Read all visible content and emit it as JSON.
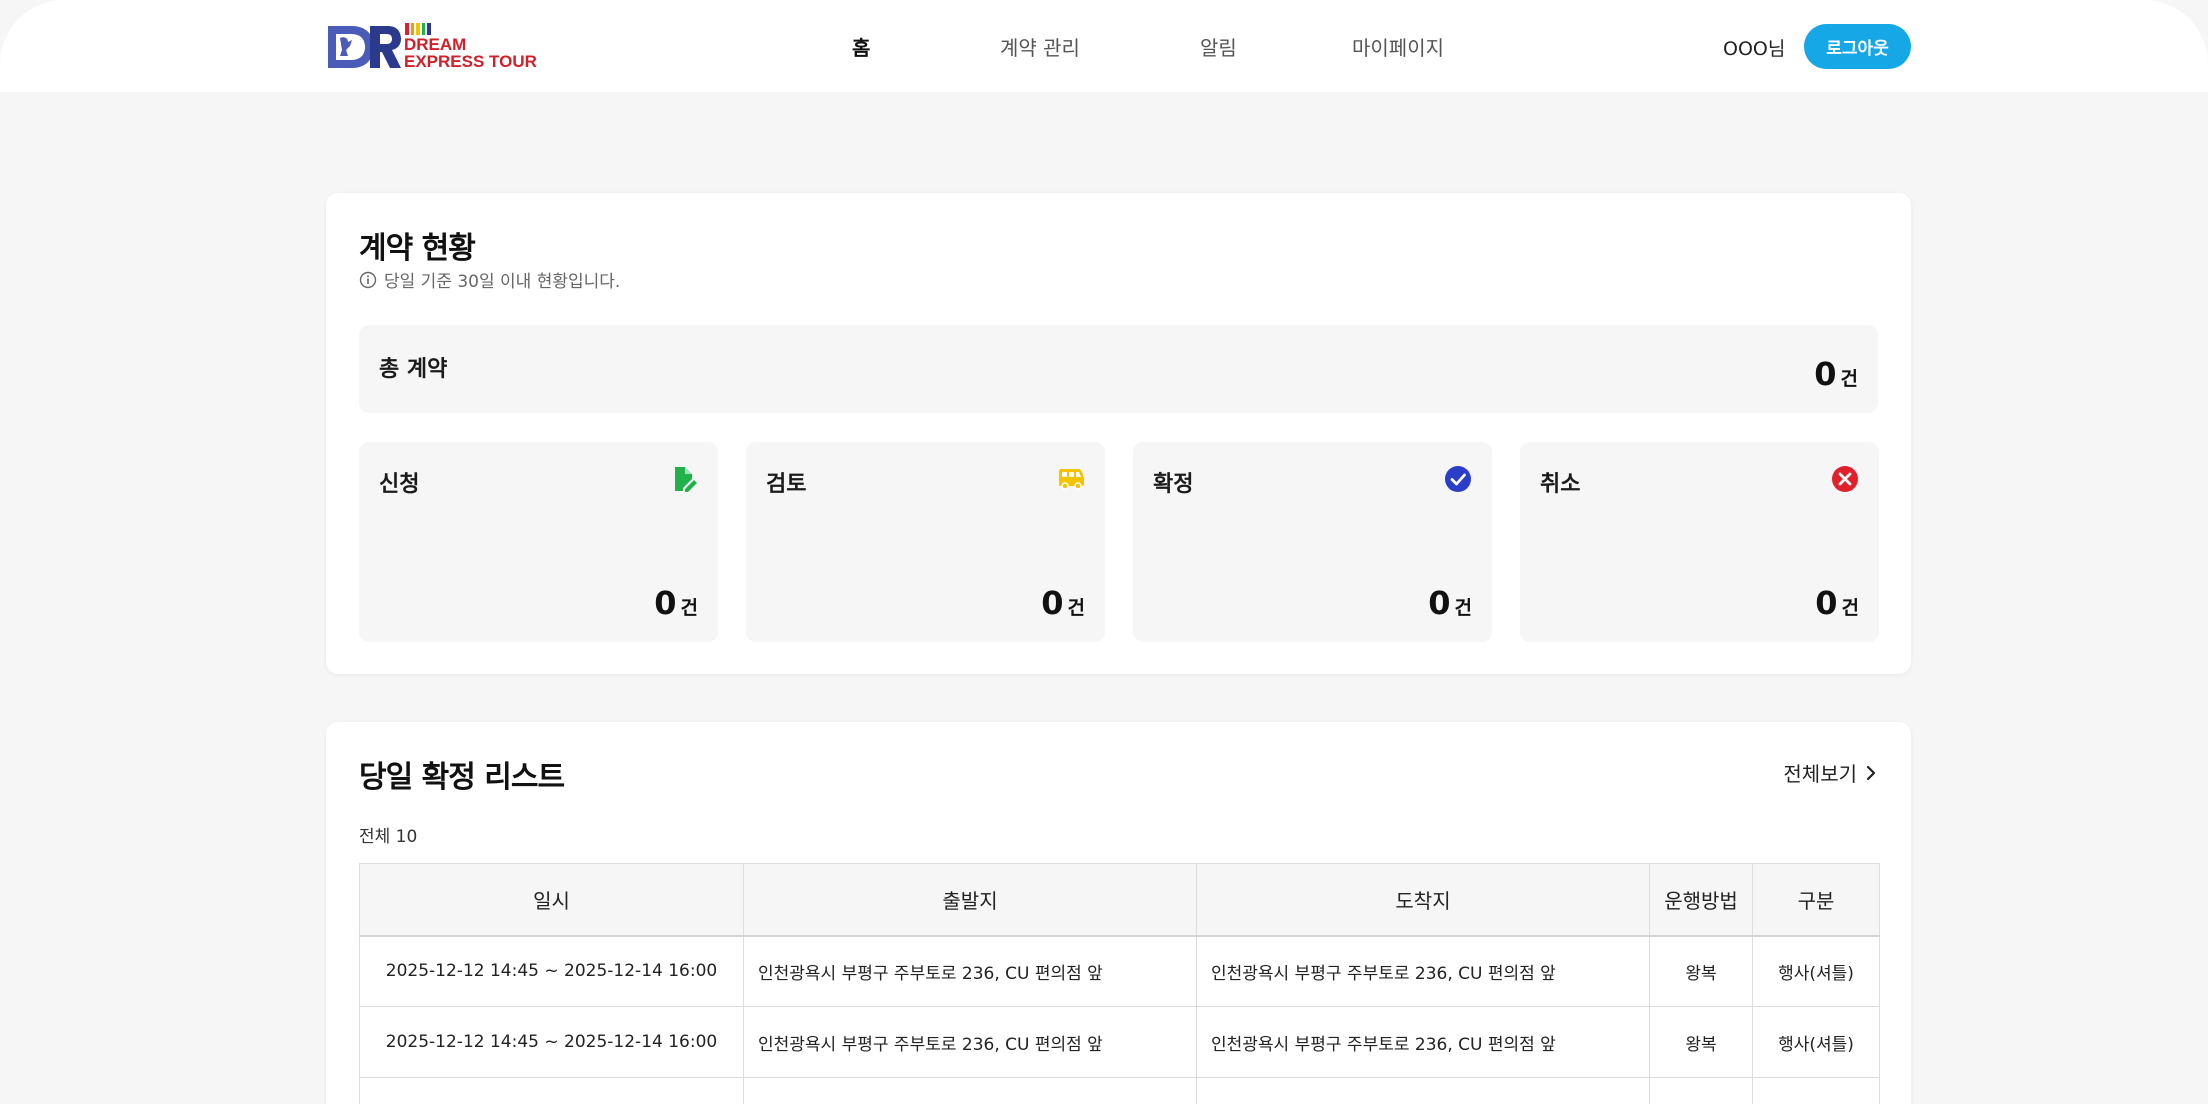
{
  "header": {
    "logo_text_line1": "DREAM",
    "logo_text_line2": "EXPRESS TOUR",
    "nav": [
      {
        "label": "홈",
        "active": true
      },
      {
        "label": "계약 관리",
        "active": false
      },
      {
        "label": "알림",
        "active": false
      },
      {
        "label": "마이페이지",
        "active": false
      }
    ],
    "user_name": "OOO님",
    "logout_label": "로그아웃"
  },
  "status": {
    "title": "계약 현황",
    "info": "당일 기준 30일 이내 현황입니다.",
    "total": {
      "label": "총 계약",
      "value": "0",
      "unit": "건"
    },
    "items": [
      {
        "label": "신청",
        "value": "0",
        "unit": "건",
        "icon": "document-edit-icon",
        "color": "#22b24c"
      },
      {
        "label": "검토",
        "value": "0",
        "unit": "건",
        "icon": "bus-icon",
        "color": "#f5c400"
      },
      {
        "label": "확정",
        "value": "0",
        "unit": "건",
        "icon": "check-circle-icon",
        "color": "#2a3ec9"
      },
      {
        "label": "취소",
        "value": "0",
        "unit": "건",
        "icon": "x-circle-icon",
        "color": "#e0202a"
      }
    ]
  },
  "list": {
    "title": "당일 확정 리스트",
    "view_all": "전체보기",
    "total_count": "전체 10",
    "columns": [
      "일시",
      "출발지",
      "도착지",
      "운행방법",
      "구분"
    ],
    "rows": [
      [
        "2025-12-12 14:45 ~ 2025-12-14 16:00",
        "인천광욕시 부평구 주부토로 236, CU 편의점 앞",
        "인천광욕시 부평구 주부토로 236, CU 편의점 앞",
        "왕복",
        "행사(셔틀)"
      ],
      [
        "2025-12-12 14:45 ~ 2025-12-14 16:00",
        "인천광욕시 부평구 주부토로 236, CU 편의점 앞",
        "인천광욕시 부평구 주부토로 236, CU 편의점 앞",
        "왕복",
        "행사(셔틀)"
      ],
      [
        "",
        "",
        "",
        "",
        ""
      ]
    ]
  },
  "colors": {
    "accent": "#15a7e6",
    "logo_red": "#d0202a",
    "logo_navy": "#2b3a8c"
  }
}
